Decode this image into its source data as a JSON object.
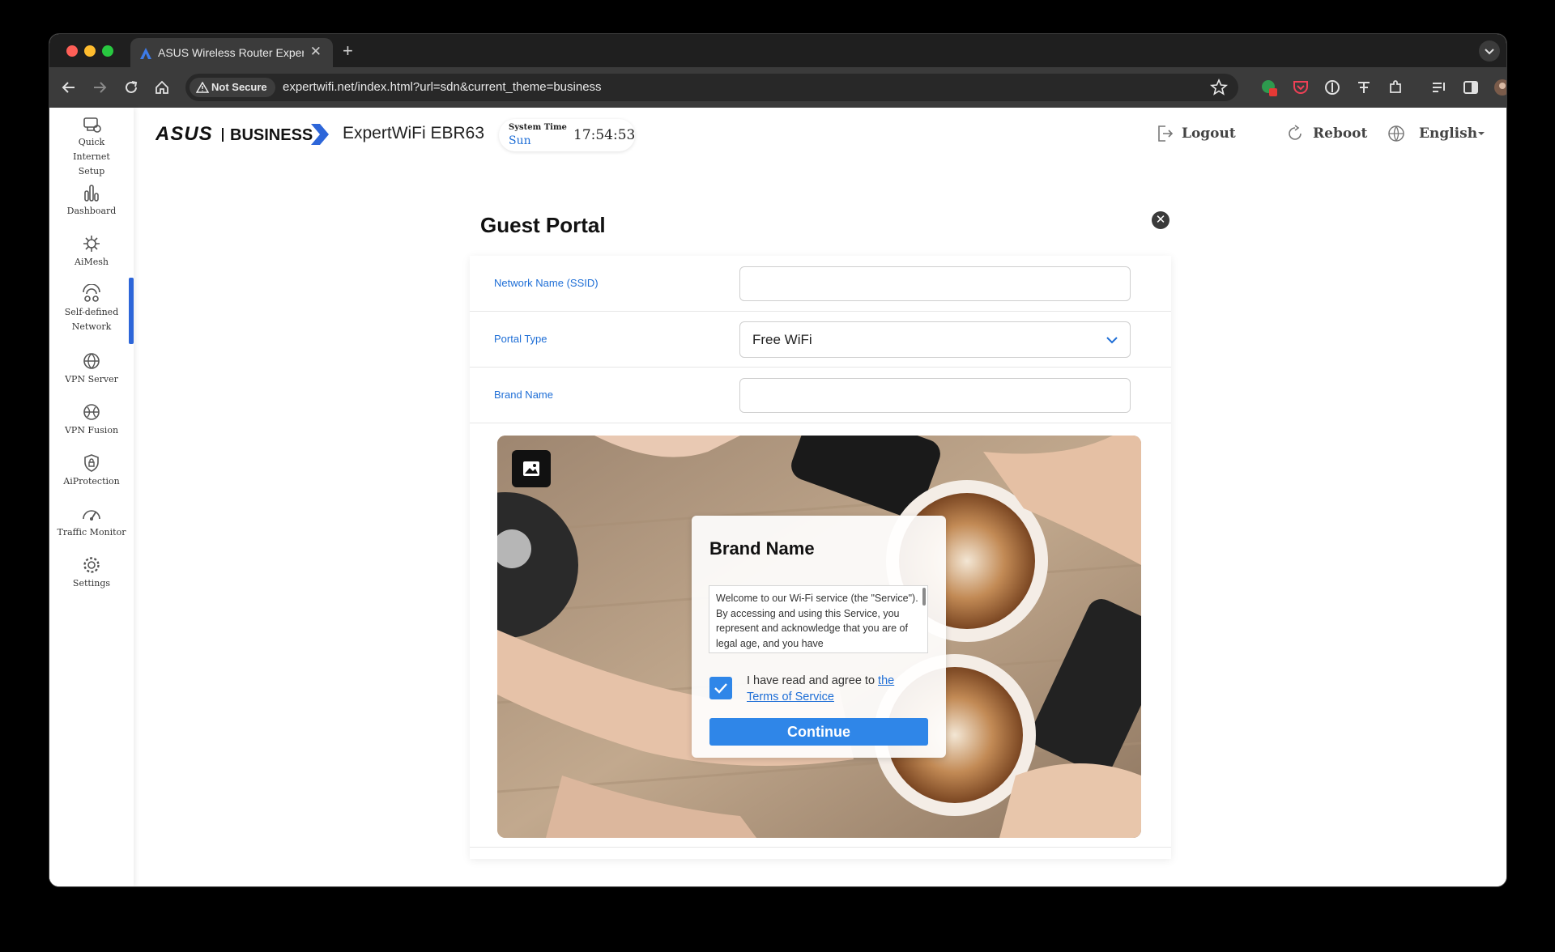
{
  "browser": {
    "tab_title": "ASUS Wireless Router Exper",
    "tab_close": "✕",
    "new_tab": "+",
    "security_label": "Not Secure",
    "url": "expertwifi.net/index.html?url=sdn&current_theme=business"
  },
  "sidebar": {
    "items": [
      {
        "label": "Quick Internet Setup",
        "icon": "quick-setup-icon"
      },
      {
        "label": "Dashboard",
        "icon": "dashboard-icon"
      },
      {
        "label": "AiMesh",
        "icon": "aimesh-icon"
      },
      {
        "label": "Self-defined Network",
        "icon": "self-defined-network-icon",
        "active": true
      },
      {
        "label": "VPN Server",
        "icon": "vpn-server-icon"
      },
      {
        "label": "VPN Fusion",
        "icon": "vpn-fusion-icon"
      },
      {
        "label": "AiProtection",
        "icon": "aiprotection-icon"
      },
      {
        "label": "Traffic Monitor",
        "icon": "traffic-monitor-icon"
      },
      {
        "label": "Settings",
        "icon": "settings-icon"
      }
    ]
  },
  "header": {
    "brand": "ASUS",
    "brand_sub": "BUSINESS",
    "model": "ExpertWiFi EBR63",
    "system_time_label": "System Time",
    "day": "Sun",
    "time": "17:54:53",
    "logout": "Logout",
    "reboot": "Reboot",
    "language": "English"
  },
  "modal": {
    "title": "Guest Portal",
    "close": "✕",
    "fields": {
      "ssid_label": "Network Name (SSID)",
      "ssid_value": "",
      "portal_type_label": "Portal Type",
      "portal_type_value": "Free WiFi",
      "brand_name_label": "Brand Name",
      "brand_name_value": ""
    },
    "preview": {
      "card_title": "Brand Name",
      "tos_text": "Welcome to our Wi-Fi service (the \"Service\"). By accessing and using this Service, you represent and acknowledge that you are of legal age, and you have",
      "agree_text": "I have read and agree to ",
      "agree_link": "the Terms of Service",
      "agree_checked": true,
      "continue_label": "Continue"
    }
  },
  "colors": {
    "accent": "#1e6ed6",
    "button": "#2f86e8",
    "active_bar": "#2d66d9"
  }
}
